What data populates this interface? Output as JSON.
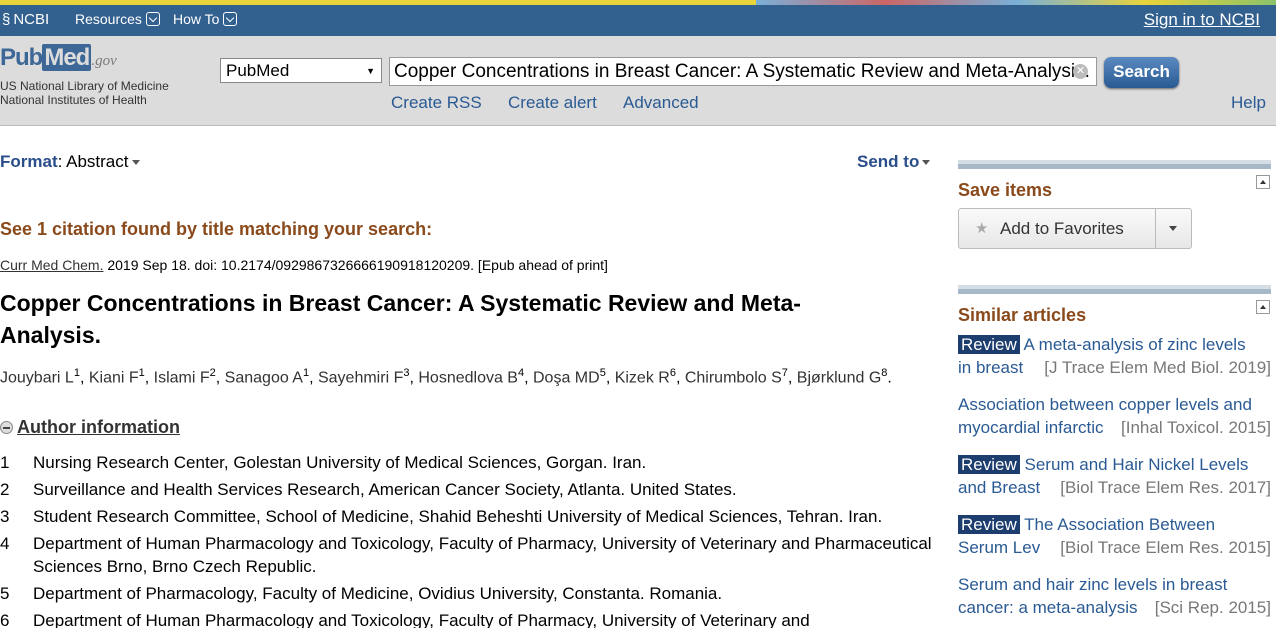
{
  "ncbi_bar": {
    "logo": "NCBI",
    "resources": "Resources",
    "howto": "How To",
    "signin": "Sign in to NCBI"
  },
  "header": {
    "logo_pub": "Pub",
    "logo_med": "Med",
    "logo_gov": ".gov",
    "nlm_line1": "US National Library of Medicine",
    "nlm_line2": "National Institutes of Health",
    "db_selected": "PubMed",
    "search_value": "Copper Concentrations in Breast Cancer: A Systematic Review and Meta-Analysis.",
    "search_button": "Search",
    "create_rss": "Create RSS",
    "create_alert": "Create alert",
    "advanced": "Advanced",
    "help": "Help"
  },
  "main": {
    "format_label": "Format",
    "format_value": ": Abstract",
    "send_to": "Send to",
    "citation_found": "See 1 citation found by title matching your search:",
    "journal": "Curr Med Chem.",
    "journal_rest": " 2019 Sep 18. doi: 10.2174/0929867326666190918120209. [Epub ahead of print]",
    "title": "Copper Concentrations in Breast Cancer: A Systematic Review and Meta-Analysis.",
    "authors": [
      {
        "name": "Jouybari L",
        "sup": "1"
      },
      {
        "name": "Kiani F",
        "sup": "1"
      },
      {
        "name": "Islami F",
        "sup": "2"
      },
      {
        "name": "Sanagoo A",
        "sup": "1"
      },
      {
        "name": "Sayehmiri F",
        "sup": "3"
      },
      {
        "name": "Hosnedlova B",
        "sup": "4"
      },
      {
        "name": "Doşa MD",
        "sup": "5"
      },
      {
        "name": "Kizek R",
        "sup": "6"
      },
      {
        "name": "Chirumbolo S",
        "sup": "7"
      },
      {
        "name": "Bjørklund G",
        "sup": "8"
      }
    ],
    "author_info": "Author information",
    "affiliations": [
      {
        "n": "1",
        "text": "Nursing Research Center, Golestan University of Medical Sciences, Gorgan. Iran."
      },
      {
        "n": "2",
        "text": "Surveillance and Health Services Research, American Cancer Society, Atlanta. United States."
      },
      {
        "n": "3",
        "text": "Student Research Committee, School of Medicine, Shahid Beheshti University of Medical Sciences, Tehran. Iran."
      },
      {
        "n": "4",
        "text": "Department of Human Pharmacology and Toxicology, Faculty of Pharmacy, University of Veterinary and Pharmaceutical Sciences Brno, Brno Czech Republic."
      },
      {
        "n": "5",
        "text": "Department of Pharmacology, Faculty of Medicine, Ovidius University, Constanta. Romania."
      },
      {
        "n": "6",
        "text": "Department of Human Pharmacology and Toxicology, Faculty of Pharmacy, University of Veterinary and"
      }
    ]
  },
  "sidebar": {
    "save_items": "Save items",
    "add_favorites": "Add to Favorites",
    "similar_articles": "Similar articles",
    "similar": [
      {
        "badge": "Review",
        "line1": "A meta-analysis of zinc levels",
        "line2": "in breast",
        "source": "[J Trace Elem Med Biol. 2019]"
      },
      {
        "badge": "",
        "line1": "Association between copper levels and",
        "line2": "myocardial infarctic",
        "source": "[Inhal Toxicol. 2015]"
      },
      {
        "badge": "Review",
        "line1": "Serum and Hair Nickel Levels",
        "line2": "and Breast",
        "source": "[Biol Trace Elem Res. 2017]"
      },
      {
        "badge": "Review",
        "line1": "The Association Between",
        "line2": "Serum Lev",
        "source": "[Biol Trace Elem Res. 2015]"
      },
      {
        "badge": "",
        "line1": "Serum and hair zinc levels in breast",
        "line2": "cancer: a meta-analysis",
        "source": "[Sci Rep. 2015]"
      }
    ]
  }
}
